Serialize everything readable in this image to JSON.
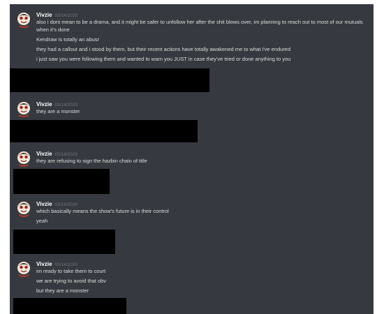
{
  "messages": [
    {
      "author": "Vivzie",
      "timestamp": "03/14/2020",
      "lines": [
        "also i dont mean to be a drama, and it might be safer to unfollow her after the shit blows over, im planning to reach out to most of our mutuals when it's done",
        "Kendraw is totally an abusr",
        "they had a callout and i stood by them, but their recent actions have totally awakened me to what i've endured",
        "i just saw you were following them and wanted to warn you JUST in case they've tried or done anything to you"
      ]
    },
    {
      "author": "Vivzie",
      "timestamp": "03/14/2020",
      "lines": [
        "they are a monster"
      ]
    },
    {
      "author": "Vivzie",
      "timestamp": "03/14/2020",
      "lines": [
        "they are refusing to sign the hazbin chain of title"
      ]
    },
    {
      "author": "Vivzie",
      "timestamp": "03/14/2020",
      "lines": [
        "which basically means the show's future is in their control",
        "yeah"
      ]
    },
    {
      "author": "Vivzie",
      "timestamp": "03/14/2020",
      "lines": [
        "im ready to take them to court",
        "we are trying to avoid that obv",
        "but they are a monster"
      ]
    }
  ]
}
